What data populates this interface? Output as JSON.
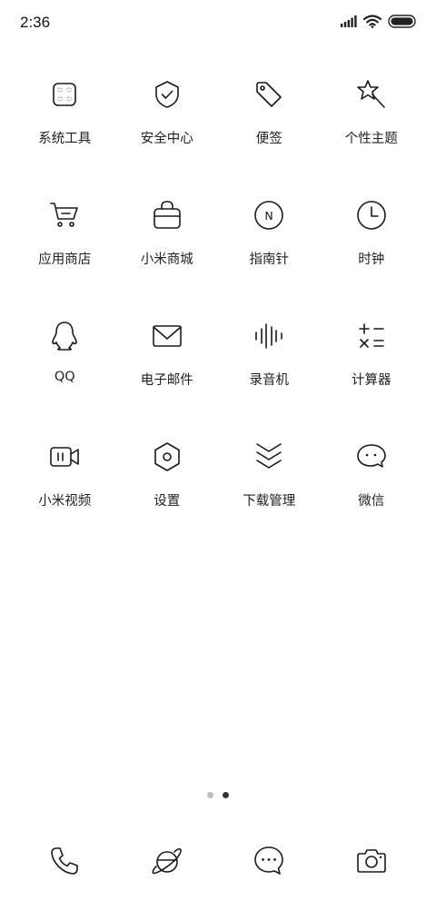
{
  "status_bar": {
    "time": "2:36",
    "icons": [
      "signal-icon",
      "wifi-icon",
      "battery-icon"
    ]
  },
  "apps": [
    {
      "label": "系统工具",
      "icon": "folder-icon"
    },
    {
      "label": "安全中心",
      "icon": "shield-check-icon"
    },
    {
      "label": "便签",
      "icon": "tag-icon"
    },
    {
      "label": "个性主题",
      "icon": "magic-wand-star-icon"
    },
    {
      "label": "应用商店",
      "icon": "shopping-cart-icon"
    },
    {
      "label": "小米商城",
      "icon": "shopping-bag-icon"
    },
    {
      "label": "指南针",
      "icon": "compass-icon"
    },
    {
      "label": "时钟",
      "icon": "clock-icon"
    },
    {
      "label": "QQ",
      "icon": "penguin-icon"
    },
    {
      "label": "电子邮件",
      "icon": "mail-icon"
    },
    {
      "label": "录音机",
      "icon": "waveform-icon"
    },
    {
      "label": "计算器",
      "icon": "calculator-icon"
    },
    {
      "label": "小米视频",
      "icon": "video-camera-icon"
    },
    {
      "label": "设置",
      "icon": "gear-icon"
    },
    {
      "label": "下载管理",
      "icon": "download-chevrons-icon"
    },
    {
      "label": "微信",
      "icon": "chat-bubble-icon"
    }
  ],
  "compass_letter": "N",
  "page_indicator": {
    "count": 2,
    "active": 2
  },
  "dock": [
    {
      "icon": "phone-icon"
    },
    {
      "icon": "browser-icon"
    },
    {
      "icon": "messages-icon"
    },
    {
      "icon": "camera-icon"
    }
  ]
}
